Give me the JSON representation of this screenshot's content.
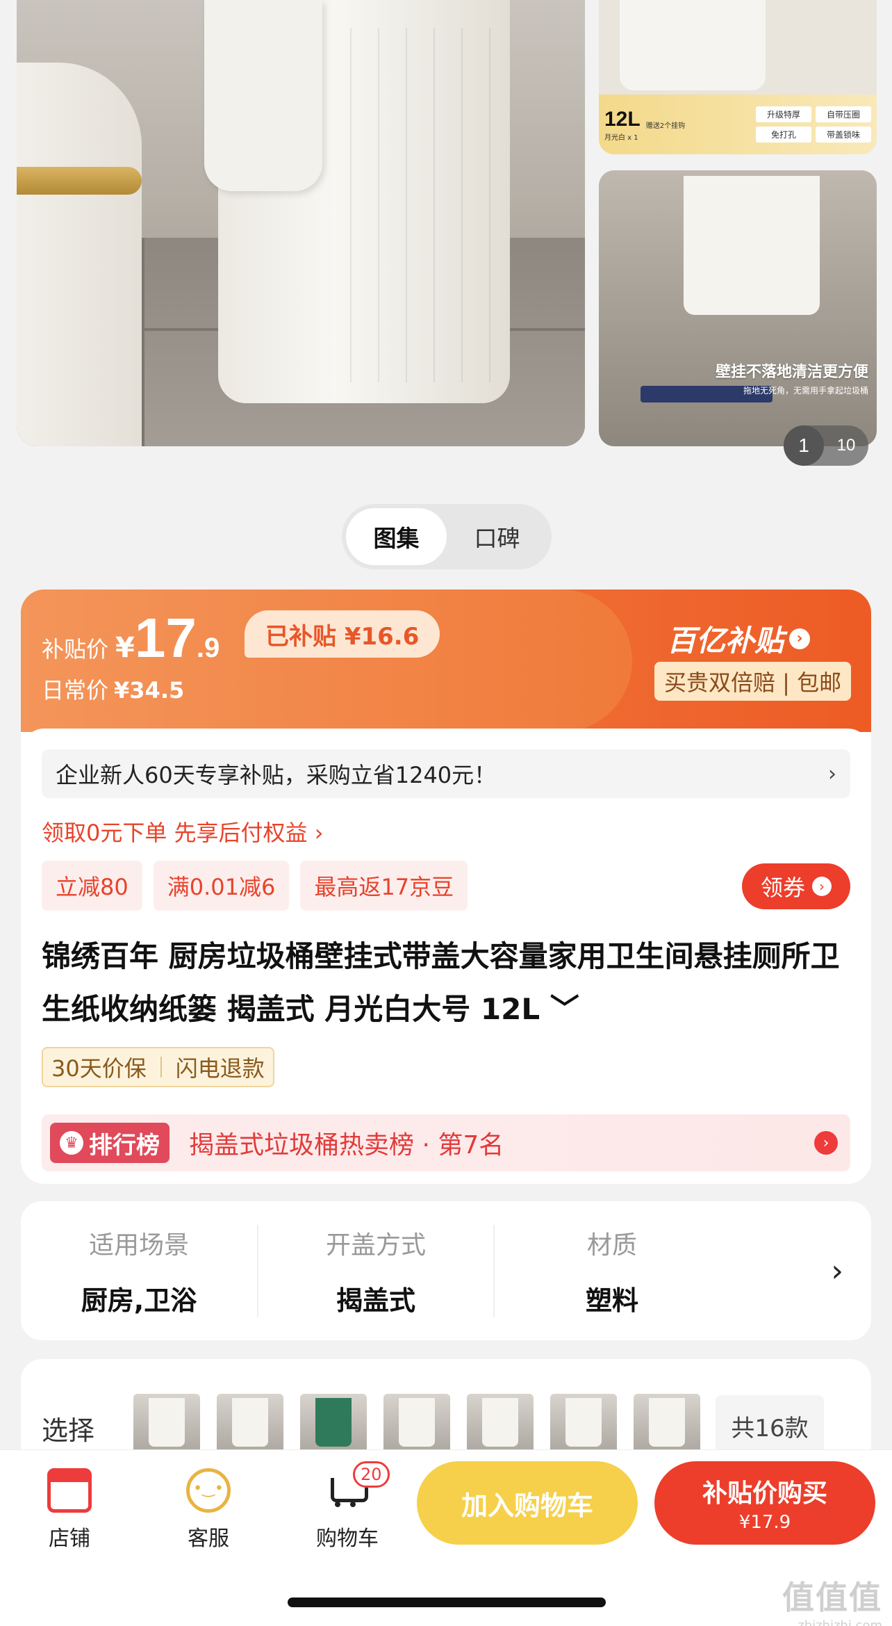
{
  "gallery": {
    "side_top": {
      "size": "12L",
      "caption": "月光白 x 1",
      "gift": "赠送2个挂钩",
      "tags": [
        "升级特厚",
        "自带压圈",
        "免打孔",
        "带盖锁味"
      ]
    },
    "side_bottom": {
      "headline": "壁挂不落地清洁更方便",
      "sub": "拖地无死角，无需用手拿起垃圾桶"
    },
    "counter": {
      "current": "1",
      "total": "10"
    }
  },
  "tabs": [
    "图集",
    "口碑"
  ],
  "price": {
    "label": "补贴价",
    "yen": "¥",
    "int": "17",
    "dec": ".9",
    "saved": "已补贴 ¥16.6",
    "daily_label": "日常价",
    "daily_value": "¥34.5",
    "brand": "百亿补贴",
    "brand_tag": "买贵双倍赔 | 包邮"
  },
  "promo": {
    "text": "企业新人60天专享补贴，采购立省1240元！",
    "chevron": "›"
  },
  "pay_link": "领取0元下单 先享后付权益 ›",
  "coupons": [
    "立减80",
    "满0.01减6",
    "最高返17京豆"
  ],
  "get_coupon": "领券",
  "title": "锦绣百年 厨房垃圾桶壁挂式带盖大容量家用卫生间悬挂厕所卫生纸收纳纸篓 揭盖式 月光白大号 12L ﹀",
  "guarantee": [
    "30天价保",
    "闪电退款"
  ],
  "rank": {
    "badge": "排行榜",
    "text": "揭盖式垃圾桶热卖榜 · 第7名"
  },
  "attrs": [
    {
      "k": "适用场景",
      "v": "厨房,卫浴"
    },
    {
      "k": "开盖方式",
      "v": "揭盖式"
    },
    {
      "k": "材质",
      "v": "塑料"
    }
  ],
  "select": {
    "label": "选择",
    "total": "共16款"
  },
  "bottom": {
    "store": "店铺",
    "service": "客服",
    "cart": "购物车",
    "cart_count": "20",
    "add_cart": "加入购物车",
    "buy": "补贴价购买",
    "buy_price": "¥17.9"
  },
  "watermark": {
    "w1": "值值值",
    "w2": "zhizhizhi.com"
  }
}
